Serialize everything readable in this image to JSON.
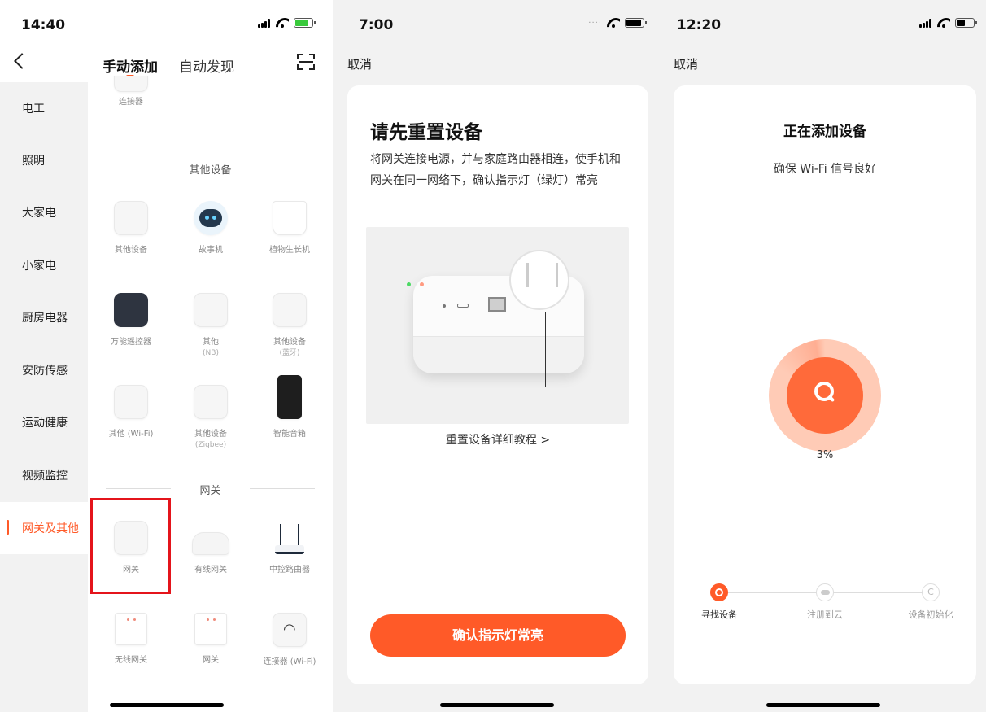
{
  "colors": {
    "accent": "#ff5a28",
    "highlight": "#e4141b"
  },
  "phone1": {
    "status_time": "14:40",
    "tabs": {
      "manual": "手动添加",
      "auto": "自动发现"
    },
    "sidebar": [
      {
        "label": "电工"
      },
      {
        "label": "照明"
      },
      {
        "label": "大家电"
      },
      {
        "label": "小家电"
      },
      {
        "label": "厨房电器"
      },
      {
        "label": "安防传感"
      },
      {
        "label": "运动健康"
      },
      {
        "label": "视频监控"
      },
      {
        "label": "网关及其他",
        "active": true
      }
    ],
    "top_item": "连接器",
    "sections": {
      "other": "其他设备",
      "gateway": "网关"
    },
    "devices": [
      {
        "label": "其他设备"
      },
      {
        "label": "故事机"
      },
      {
        "label": "植物生长机"
      },
      {
        "label": "万能遥控器"
      },
      {
        "label": "其他",
        "sub": "(NB)"
      },
      {
        "label": "其他设备",
        "sub": "(蓝牙)"
      },
      {
        "label": "其他 (Wi-Fi)"
      },
      {
        "label": "其他设备",
        "sub": "(Zigbee)"
      },
      {
        "label": "智能音箱"
      }
    ],
    "gateways": [
      {
        "label": "网关"
      },
      {
        "label": "有线网关"
      },
      {
        "label": "中控路由器"
      },
      {
        "label": "无线网关"
      },
      {
        "label": "网关"
      },
      {
        "label": "连接器 (Wi-Fi)"
      }
    ]
  },
  "phone2": {
    "status_time": "7:00",
    "cancel": "取消",
    "title": "请先重置设备",
    "description": "将网关连接电源，并与家庭路由器相连，使手机和网关在同一网络下，确认指示灯（绿灯）常亮",
    "tutorial_link": "重置设备详细教程 >",
    "confirm_button": "确认指示灯常亮"
  },
  "phone3": {
    "status_time": "12:20",
    "cancel": "取消",
    "title": "正在添加设备",
    "subtitle": "确保 Wi-Fi 信号良好",
    "progress": "3%",
    "steps": [
      {
        "label": "寻找设备",
        "active": true
      },
      {
        "label": "注册到云",
        "active": false
      },
      {
        "label": "设备初始化",
        "active": false
      }
    ],
    "step3_glyph": "C"
  }
}
